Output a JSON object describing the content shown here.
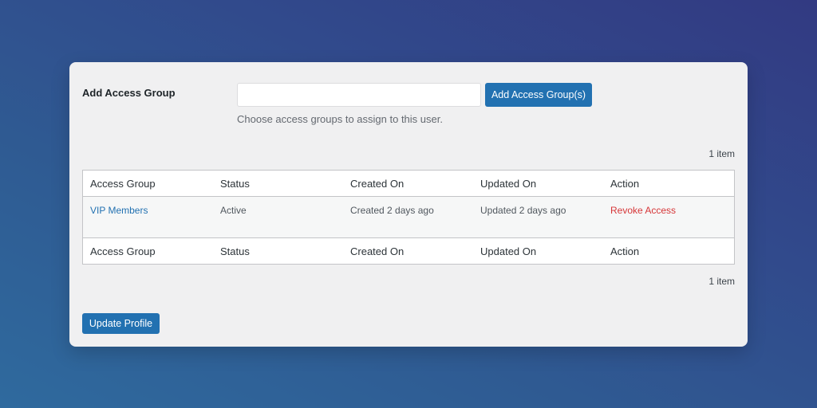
{
  "form": {
    "label": "Add Access Group",
    "input_value": "",
    "input_placeholder": "",
    "add_button_label": "Add Access Group(s)",
    "description": "Choose access groups to assign to this user."
  },
  "table": {
    "count_top": "1 item",
    "count_bottom": "1 item",
    "columns": [
      "Access Group",
      "Status",
      "Created On",
      "Updated On",
      "Action"
    ],
    "rows": [
      {
        "access_group": "VIP Members",
        "status": "Active",
        "created_on": "Created 2 days ago",
        "updated_on": "Updated 2 days ago",
        "action": "Revoke Access"
      }
    ]
  },
  "footer": {
    "update_button_label": "Update Profile"
  },
  "colors": {
    "primary": "#2271b1",
    "danger": "#d63638"
  }
}
